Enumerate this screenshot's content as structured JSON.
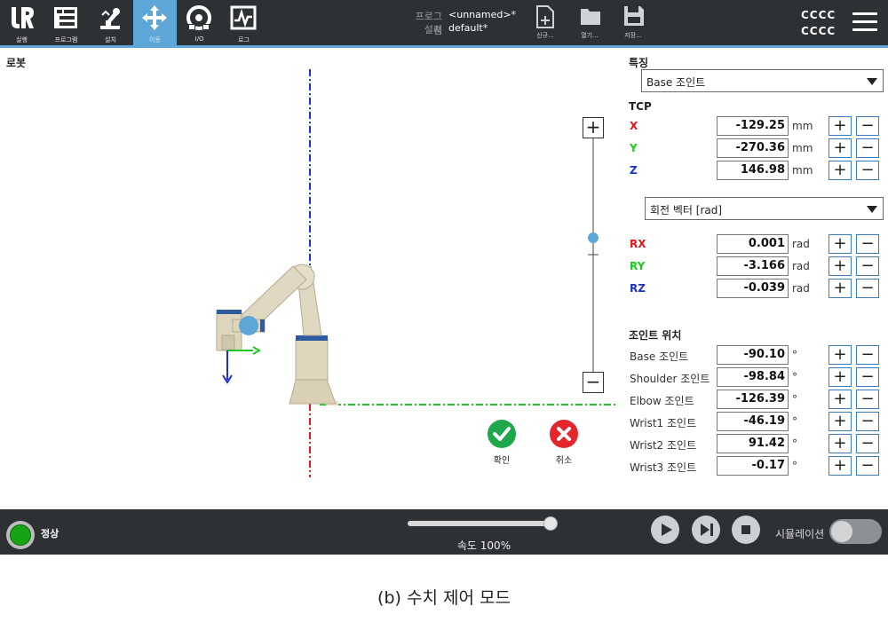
{
  "nav": {
    "tabs": [
      {
        "label": "실행",
        "icon": "ur-logo-icon"
      },
      {
        "label": "프로그램",
        "icon": "program-icon"
      },
      {
        "label": "설치",
        "icon": "installation-icon"
      },
      {
        "label": "이동",
        "icon": "move-icon",
        "active": true
      },
      {
        "label": "I/O",
        "icon": "io-icon"
      },
      {
        "label": "로그",
        "icon": "log-icon"
      }
    ]
  },
  "program": {
    "program_label": "프로그램",
    "program_name": "<unnamed>*",
    "install_label": "설치",
    "install_name": "default*"
  },
  "file_buttons": {
    "new": "신규...",
    "open": "열기...",
    "save": "저장..."
  },
  "top_right": {
    "line1": "CCCC",
    "line2": "CCCC"
  },
  "robot_panel": {
    "title": "로봇"
  },
  "actions": {
    "ok": "확인",
    "cancel": "취소"
  },
  "feature": {
    "title": "특징",
    "selected": "Base 조인트"
  },
  "tcp": {
    "title": "TCP",
    "position": [
      {
        "name": "X",
        "value": "-129.25",
        "unit": "mm",
        "color": "#e0161b"
      },
      {
        "name": "Y",
        "value": "-270.36",
        "unit": "mm",
        "color": "#1ec81e"
      },
      {
        "name": "Z",
        "value": "146.98",
        "unit": "mm",
        "color": "#1a2fd0"
      }
    ],
    "rotation_selected": "회전 벡터 [rad]",
    "rotation": [
      {
        "name": "RX",
        "value": "0.001",
        "unit": "rad",
        "color": "#e0161b"
      },
      {
        "name": "RY",
        "value": "-3.166",
        "unit": "rad",
        "color": "#1ec81e"
      },
      {
        "name": "RZ",
        "value": "-0.039",
        "unit": "rad",
        "color": "#1a2fd0"
      }
    ]
  },
  "joints": {
    "title": "조인트 위치",
    "items": [
      {
        "name": "Base 조인트",
        "value": "-90.10",
        "unit": "°"
      },
      {
        "name": "Shoulder 조인트",
        "value": "-98.84",
        "unit": "°"
      },
      {
        "name": "Elbow 조인트",
        "value": "-126.39",
        "unit": "°"
      },
      {
        "name": "Wrist1 조인트",
        "value": "-46.19",
        "unit": "°"
      },
      {
        "name": "Wrist2 조인트",
        "value": "91.42",
        "unit": "°"
      },
      {
        "name": "Wrist3 조인트",
        "value": "-0.17",
        "unit": "°"
      }
    ]
  },
  "buttons": {
    "plus": "+",
    "minus": "−"
  },
  "bottom": {
    "status": "정상",
    "speed": "속도 100%",
    "speed_value_percent": 100,
    "simulation_label": "시뮬레이션",
    "simulation_on": false
  },
  "caption": "(b) 수치 제어 모드"
}
